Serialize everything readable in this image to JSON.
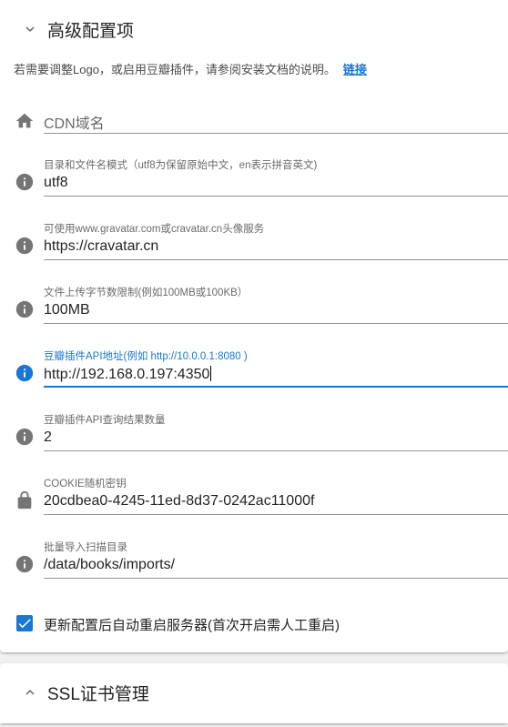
{
  "advanced_panel": {
    "title": "高级配置项",
    "intro_text": "若需要调整Logo，或启用豆瓣插件，请参阅安装文档的说明。",
    "intro_link": "链接",
    "fields": [
      {
        "icon": "home-icon",
        "label": "",
        "value": "",
        "placeholder": "CDN域名"
      },
      {
        "icon": "info-icon",
        "label": "目录和文件名模式（utf8为保留原始中文，en表示拼音英文)",
        "value": "utf8"
      },
      {
        "icon": "info-icon",
        "label": "可使用www.gravatar.com或cravatar.cn头像服务",
        "value": "https://cravatar.cn"
      },
      {
        "icon": "info-icon",
        "label": "文件上传字节数限制(例如100MB或100KB）",
        "value": "100MB"
      },
      {
        "icon": "info-icon",
        "label": "豆瓣插件API地址(例如 http://10.0.0.1:8080 )",
        "value": "http://192.168.0.197:4350",
        "focused": true
      },
      {
        "icon": "info-icon",
        "label": "豆瓣插件API查询结果数量",
        "value": "2"
      },
      {
        "icon": "lock-icon",
        "label": "COOKIE随机密钥",
        "value": "20cdbea0-4245-11ed-8d37-0242ac11000f"
      },
      {
        "icon": "info-icon",
        "label": "批量导入扫描目录",
        "value": "/data/books/imports/"
      }
    ],
    "checkbox": {
      "label": "更新配置后自动重启服务器(首次开启需人工重启)",
      "checked": true
    }
  },
  "ssl_panel": {
    "title": "SSL证书管理"
  },
  "colors": {
    "accent": "#1976d2",
    "icon_grey": "#757575",
    "background": "#f1f1f1"
  }
}
